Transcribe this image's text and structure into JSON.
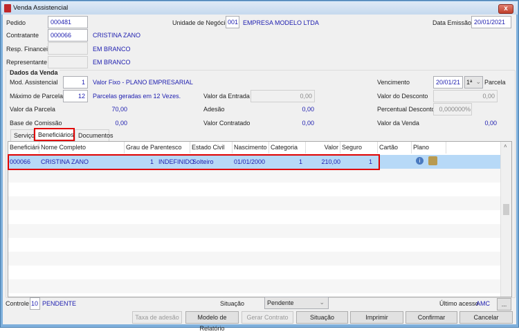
{
  "window": {
    "title": "Venda Assistencial",
    "close": "x"
  },
  "header": {
    "pedido_label": "Pedido",
    "pedido": "000481",
    "contratante_label": "Contratante",
    "contratante_code": "000066",
    "contratante_name": "CRISTINA ZANO",
    "resp_label": "Resp. Financeiro",
    "resp_name": "EM BRANCO",
    "rep_label": "Representante",
    "rep_name": "EM BRANCO",
    "unidade_label": "Unidade de Negócio",
    "unidade_code": "001",
    "unidade_name": "EMPRESA MODELO LTDA",
    "data_label": "Data Emissão",
    "data": "20/01/2021"
  },
  "dados": {
    "title": "Dados da Venda",
    "mod_label": "Mod. Assistencial",
    "mod": "1",
    "mod_text": "Valor Fixo - PLANO EMPRESARIAL",
    "max_label": "Máximo de Parcelas",
    "max": "12",
    "max_text": "Parcelas geradas em 12 Vezes.",
    "valor_parcela_label": "Valor da Parcela",
    "valor_parcela": "70,00",
    "base_label": "Base de Comissão",
    "base": "0,00",
    "entrada_label": "Valor da Entrada",
    "entrada": "0,00",
    "adesao_label": "Adesão",
    "adesao": "0,00",
    "contratado_label": "Valor Contratado",
    "contratado": "0,00",
    "venc_label": "Vencimento",
    "venc": "20/01/21",
    "parcela_sel": "1ª",
    "parcela_label": "Parcela",
    "desconto_label": "Valor do Desconto",
    "desconto": "0,00",
    "perc_label": "Percentual Desconto",
    "perc": "0,000000%",
    "venda_label": "Valor da Venda",
    "venda": "0,00"
  },
  "tabs": [
    "Serviços",
    "Beneficiários",
    "Documentos"
  ],
  "grid": {
    "headers": [
      "Beneficiário",
      "Nome Completo",
      "Grau de Parentesco",
      "Estado Civil",
      "Nascimento",
      "Categoria",
      "Valor",
      "Seguro",
      "Cartão",
      "Plano"
    ],
    "rows": [
      {
        "beneficiario": "000066",
        "nome": "CRISTINA ZANO",
        "grau": "1",
        "grau_desc": "INDEFINIDO",
        "estado": "Solteiro",
        "nascimento": "01/01/2000",
        "categoria": "1",
        "valor": "210,00",
        "seguro": "1",
        "cartao": ""
      }
    ]
  },
  "footer": {
    "controle_label": "Controle",
    "controle": "10",
    "controle_status": "PENDENTE",
    "situacao_label": "Situação",
    "situacao": "Pendente",
    "ultimo_label": "Último acesso",
    "ultimo": "AMC",
    "more": "...",
    "buttons": [
      "Taxa de adesão",
      "Modelo de Relatório",
      "Gerar Contrato",
      "Situação",
      "Imprimir",
      "Confirmar",
      "Cancelar"
    ]
  },
  "colors": {
    "selected_row": "#b7d9f7",
    "highlight": "#e00000",
    "value_text": "#2020b0"
  }
}
